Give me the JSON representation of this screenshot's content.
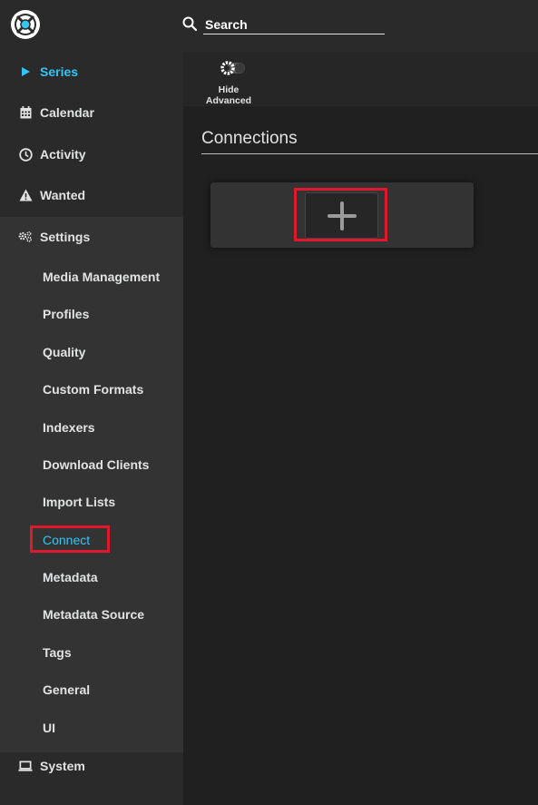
{
  "header": {
    "logo": "sonarr-logo",
    "search": {
      "placeholder": "Search",
      "value": "",
      "icon": "search-icon"
    }
  },
  "sidebar": {
    "items": [
      {
        "id": "series",
        "label": "Series",
        "icon": "play-icon",
        "active": true
      },
      {
        "id": "calendar",
        "label": "Calendar",
        "icon": "calendar-icon"
      },
      {
        "id": "activity",
        "label": "Activity",
        "icon": "clock-icon"
      },
      {
        "id": "wanted",
        "label": "Wanted",
        "icon": "warning-icon"
      },
      {
        "id": "settings",
        "label": "Settings",
        "icon": "gears-icon",
        "expanded": true
      },
      {
        "id": "system",
        "label": "System",
        "icon": "laptop-icon"
      }
    ],
    "settings_subitems": [
      "Media Management",
      "Profiles",
      "Quality",
      "Custom Formats",
      "Indexers",
      "Download Clients",
      "Import Lists",
      "Connect",
      "Metadata",
      "Metadata Source",
      "Tags",
      "General",
      "UI"
    ],
    "active_subitem": "Connect"
  },
  "toolbar": {
    "advanced_toggle": {
      "line1": "Hide",
      "line2": "Advanced",
      "icon": "gear-toggle-icon"
    }
  },
  "main": {
    "section_title": "Connections",
    "add_button_icon": "plus-icon"
  },
  "colors": {
    "accent": "#35c5f4",
    "highlight": "#e0182b",
    "sidebar_bg": "#2a2a2a",
    "settings_bg": "#333333",
    "page_bg": "#202020"
  }
}
